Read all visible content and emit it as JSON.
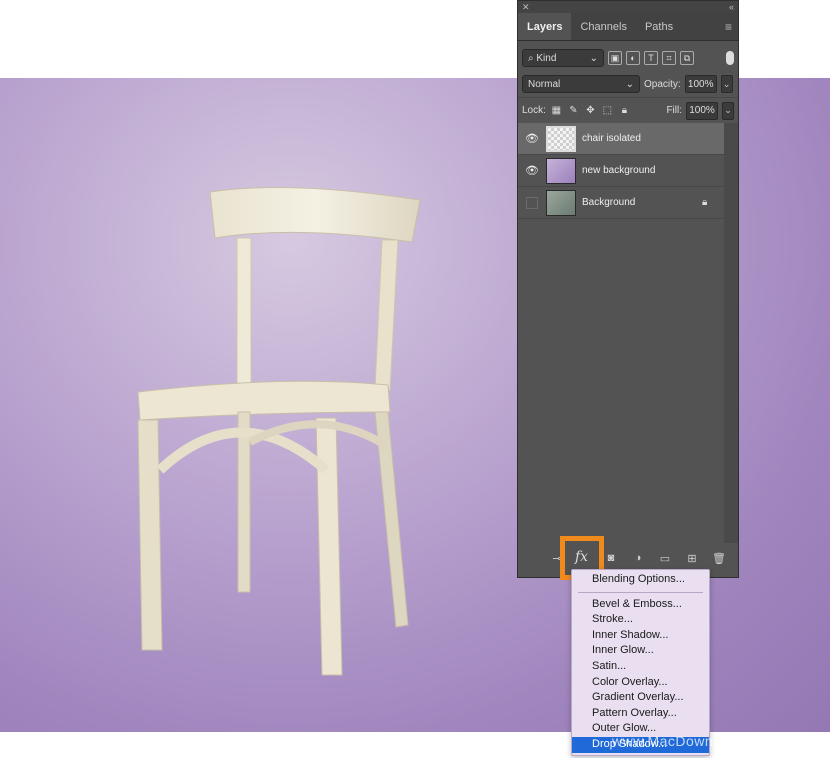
{
  "panel": {
    "tabs": [
      "Layers",
      "Channels",
      "Paths"
    ],
    "filter": {
      "kind_label": "Kind"
    },
    "blend_mode": "Normal",
    "opacity_label": "Opacity:",
    "opacity_value": "100%",
    "lock_label": "Lock:",
    "fill_label": "Fill:",
    "fill_value": "100%",
    "layers": [
      {
        "name": "chair isolated",
        "visible": true,
        "selected": true
      },
      {
        "name": "new background",
        "visible": true,
        "selected": false
      },
      {
        "name": "Background",
        "visible": false,
        "selected": false,
        "locked": true
      }
    ]
  },
  "fx_button": {
    "label": "fx"
  },
  "menu": {
    "items_top": [
      "Blending Options..."
    ],
    "items": [
      "Bevel & Emboss...",
      "Stroke...",
      "Inner Shadow...",
      "Inner Glow...",
      "Satin...",
      "Color Overlay...",
      "Gradient Overlay...",
      "Pattern Overlay...",
      "Outer Glow...",
      "Drop Shadow..."
    ],
    "active_item": "Drop Shadow..."
  },
  "watermark": "www.MacDown.com",
  "colors": {
    "highlight": "#f08a1c",
    "menu_active": "#1f6ad8"
  }
}
